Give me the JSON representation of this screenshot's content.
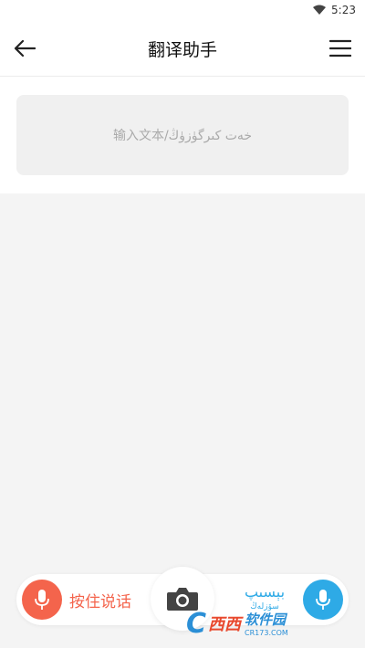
{
  "status_bar": {
    "time": "5:23"
  },
  "toolbar": {
    "title": "翻译助手"
  },
  "input": {
    "placeholder": "输入文本/خەت كىرگۈزۈڭ"
  },
  "bottom_bar": {
    "hold_to_talk_label": "按住说话",
    "uyghur_label": "بېسىپ",
    "uyghur_sub": "سۆزلەڭ"
  },
  "watermark": {
    "logo": "C",
    "cn": "西西",
    "right": "软件园",
    "url": "CR173.COM"
  },
  "colors": {
    "mic_left": "#f4644c",
    "mic_right": "#2eaae6",
    "title": "#111111"
  },
  "icons": [
    "wifi-icon",
    "back-arrow-icon",
    "menu-icon",
    "mic-icon",
    "camera-icon"
  ]
}
